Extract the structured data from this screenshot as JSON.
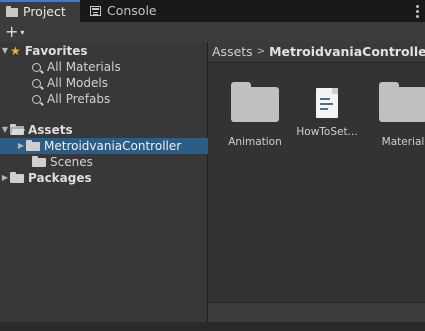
{
  "tabs": [
    {
      "label": "Project",
      "icon": "folder-icon",
      "active": true
    },
    {
      "label": "Console",
      "icon": "console-icon",
      "active": false
    }
  ],
  "toolbar": {
    "add_label": "+",
    "add_dropdown": "▾"
  },
  "tree": {
    "favorites": {
      "label": "Favorites",
      "items": [
        "All Materials",
        "All Models",
        "All Prefabs"
      ]
    },
    "assets": {
      "label": "Assets",
      "items": [
        {
          "label": "MetroidvaniaController",
          "selected": true
        },
        {
          "label": "Scenes",
          "selected": false
        }
      ]
    },
    "packages": {
      "label": "Packages"
    }
  },
  "breadcrumb": {
    "root": "Assets",
    "separator": ">",
    "current": "MetroidvaniaController"
  },
  "assets_grid": [
    {
      "label": "Animation",
      "type": "folder"
    },
    {
      "label": "HowToSet...",
      "type": "document"
    },
    {
      "label": "Material",
      "type": "folder"
    }
  ],
  "colors": {
    "selection": "#2c5d87",
    "accent": "#3a7ad8",
    "star": "#e7b52c"
  }
}
